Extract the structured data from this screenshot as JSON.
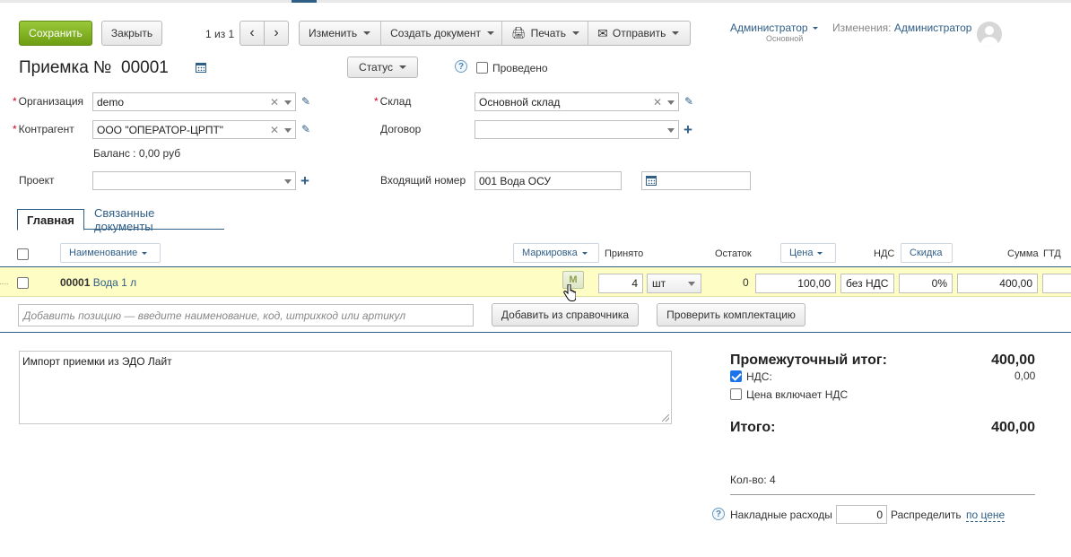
{
  "toolbar": {
    "save": "Сохранить",
    "close": "Закрыть",
    "pager": "1 из 1",
    "prev_icon": "chevron-left-icon",
    "next_icon": "chevron-right-icon",
    "edit": "Изменить",
    "create_doc": "Создать документ",
    "print": "Печать",
    "send": "Отправить"
  },
  "user": {
    "name": "Администратор",
    "role": "Основной",
    "changes_label": "Изменения:",
    "changes_user": "Администратор"
  },
  "doc": {
    "title": "Приемка №",
    "number": "00001",
    "status": "Статус",
    "posted": "Проведено"
  },
  "form": {
    "org_label": "Организация",
    "org_value": "demo",
    "counterparty_label": "Контрагент",
    "counterparty_value": "ООО \"ОПЕРАТОР-ЦРПТ\"",
    "balance": "Баланс : 0,00 руб",
    "project_label": "Проект",
    "project_value": "",
    "warehouse_label": "Склад",
    "warehouse_value": "Основной склад",
    "contract_label": "Договор",
    "contract_value": "",
    "incoming_label": "Входящий номер",
    "incoming_value": "001 Вода ОСУ",
    "incoming_date": ""
  },
  "tabs": {
    "main": "Главная",
    "related": "Связанные документы"
  },
  "table": {
    "headers": {
      "name": "Наименование",
      "marking": "Маркировка",
      "accepted": "Принято",
      "remainder": "Остаток",
      "price": "Цена",
      "vat": "НДС",
      "discount": "Скидка",
      "sum": "Сумма",
      "gtd": "ГТД"
    },
    "rows": [
      {
        "code": "00001",
        "name": "Вода 1 л",
        "mark": "М",
        "qty": "4",
        "unit": "шт",
        "remainder": "0",
        "price": "100,00",
        "vat": "без НДС",
        "discount": "0%",
        "sum": "400,00"
      }
    ],
    "add_placeholder": "Добавить позицию — введите наименование, код, штрихкод или артикул",
    "add_from_catalog": "Добавить из справочника",
    "check_set": "Проверить комплектацию"
  },
  "comment": "Импорт приемки из ЭДО Лайт",
  "totals": {
    "subtotal_label": "Промежуточный итог:",
    "subtotal_value": "400,00",
    "vat_label": "НДС:",
    "vat_value": "0,00",
    "price_incl_vat": "Цена включает НДС",
    "total_label": "Итого:",
    "total_value": "400,00",
    "qty": "Кол-во: 4",
    "overhead_label": "Накладные расходы",
    "overhead_value": "0",
    "distribute_label": "Распределить",
    "distribute_link": "по цене"
  }
}
